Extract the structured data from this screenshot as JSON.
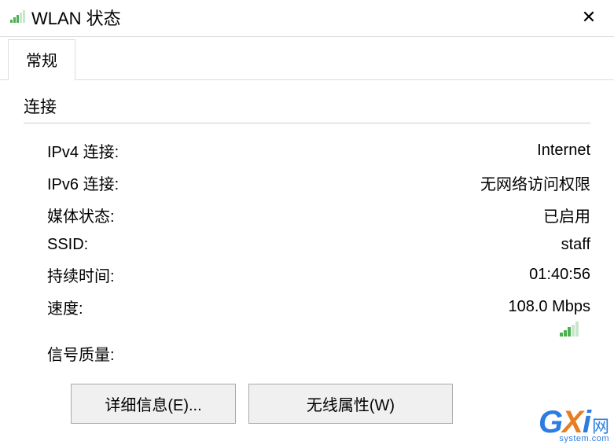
{
  "window": {
    "title": "WLAN 状态",
    "close": "✕"
  },
  "tabs": {
    "general": "常规"
  },
  "section": {
    "connection_title": "连接"
  },
  "rows": {
    "ipv4_label": "IPv4 连接:",
    "ipv4_value": "Internet",
    "ipv6_label": "IPv6 连接:",
    "ipv6_value": "无网络访问权限",
    "media_label": "媒体状态:",
    "media_value": "已启用",
    "ssid_label": "SSID:",
    "ssid_value": "staff",
    "duration_label": "持续时间:",
    "duration_value": "01:40:56",
    "speed_label": "速度:",
    "speed_value": "108.0 Mbps",
    "signal_label": "信号质量:"
  },
  "buttons": {
    "details": "详细信息(E)...",
    "wireless_props": "无线属性(W)"
  },
  "watermark": {
    "g": "G",
    "x": "X",
    "i": "i",
    "cn": "网",
    "sub": "system.com"
  }
}
